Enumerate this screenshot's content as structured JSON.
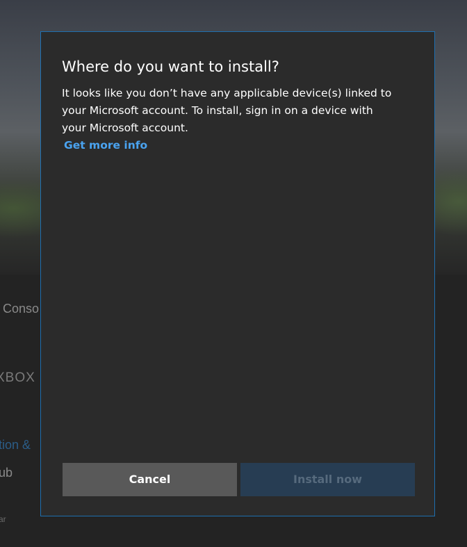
{
  "background": {
    "partial_labels": [
      "Conso",
      "XBOX",
      "tion & ",
      "ub",
      "ar"
    ]
  },
  "dialog": {
    "title": "Where do you want to install?",
    "body_lines": [
      "It looks like you don’t have any applicable device(s) linked to",
      "your Microsoft account. To install, sign in on a device with",
      "your Microsoft account."
    ],
    "link_label": "Get more info",
    "cancel_label": "Cancel",
    "install_label": "Install now"
  },
  "colors": {
    "link": "#4aa3f0",
    "dialog_border": "#1e6fb0",
    "dialog_background": "#2b2b2b",
    "cancel_button": "#595959",
    "install_button_disabled": "#273d53"
  }
}
